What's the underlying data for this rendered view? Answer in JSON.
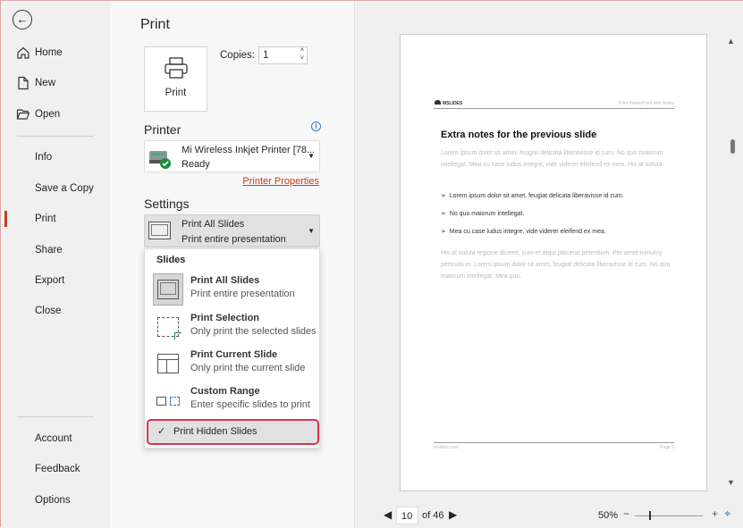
{
  "sidebar": {
    "back_icon": "arrow-left-circle-icon",
    "items": [
      {
        "label": "Home",
        "icon": "home-icon"
      },
      {
        "label": "New",
        "icon": "new-document-icon"
      },
      {
        "label": "Open",
        "icon": "folder-open-icon"
      },
      {
        "label": "Info"
      },
      {
        "label": "Save a Copy"
      },
      {
        "label": "Print",
        "active": true
      },
      {
        "label": "Share"
      },
      {
        "label": "Export"
      },
      {
        "label": "Close"
      },
      {
        "label": "Account"
      },
      {
        "label": "Feedback"
      },
      {
        "label": "Options"
      }
    ]
  },
  "print": {
    "title": "Print",
    "print_button": "Print",
    "copies_label": "Copies:",
    "copies_value": "1",
    "printer_heading": "Printer",
    "printer_name": "Mi Wireless Inkjet Printer [78...",
    "printer_status": "Ready",
    "printer_properties": "Printer Properties",
    "settings_heading": "Settings",
    "setting_title": "Print All Slides",
    "setting_sub": "Print entire presentation",
    "menu": {
      "header": "Slides",
      "items": [
        {
          "title": "Print All Slides",
          "sub": "Print entire presentation",
          "selected": true
        },
        {
          "title": "Print Selection",
          "sub": "Only print the selected slides"
        },
        {
          "title": "Print Current Slide",
          "sub": "Only print the current slide"
        },
        {
          "title": "Custom Range",
          "sub": "Enter specific slides to print"
        }
      ],
      "hidden_slides": "Print Hidden Slides",
      "hidden_checked": true
    }
  },
  "preview": {
    "logo": "MSLIDES",
    "header_right": "Print PowerPoint with Notes",
    "heading": "Extra notes for the previous slide",
    "para1": "Lorem ipsum dolor sit amet, feugiat delicata liberavisse id cum. No quo maiorum intellegat. Mea cu case ludus integre, vide viderer eleifend ex mea. His at soluta.",
    "bullets": [
      "Lorem ipsum dolor sit amet, feugiat delicata liberavisse id cum.",
      "No quo maiorum intellegat.",
      "Mea cu case ludus integre, vide viderer eleifend ex mea."
    ],
    "para2": "His at soluta regione diceret, cum et atqui placerat petentium. Per amet nonumy periculis ei. Lorem ipsum dolor sit amet, feugiat delicata liberavisse id cum. No quo maiorum intellegat. Mea quo.",
    "footer_left": "mslides.com",
    "footer_right": "Page 9",
    "page_current": "10",
    "page_of": "of 46",
    "zoom": "50%",
    "zoom_percent": 50
  },
  "colors": {
    "accent": "#c43e1c",
    "highlight_border": "#d9334f"
  }
}
